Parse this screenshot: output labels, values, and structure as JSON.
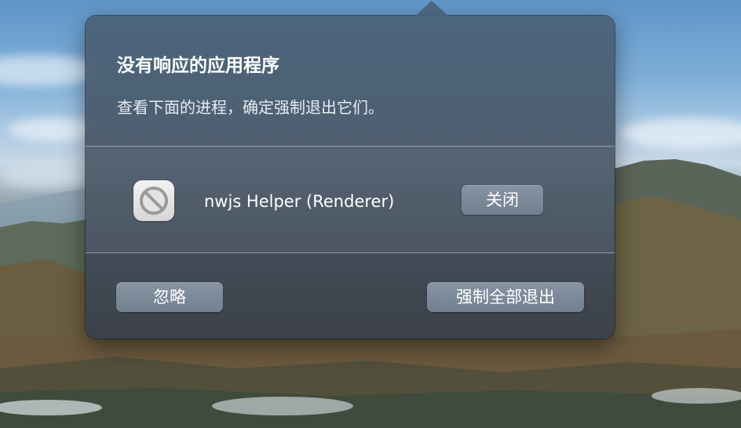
{
  "dialog": {
    "title": "没有响应的应用程序",
    "subtitle": "查看下面的进程，确定强制退出它们。"
  },
  "apps": [
    {
      "name": "nwjs Helper (Renderer)",
      "icon": "blocked-app-icon",
      "close_label": "关闭"
    }
  ],
  "footer": {
    "ignore_label": "忽略",
    "force_quit_all_label": "强制全部退出"
  },
  "colors": {
    "button_bg": "#7d8a99",
    "text": "#ffffff"
  }
}
